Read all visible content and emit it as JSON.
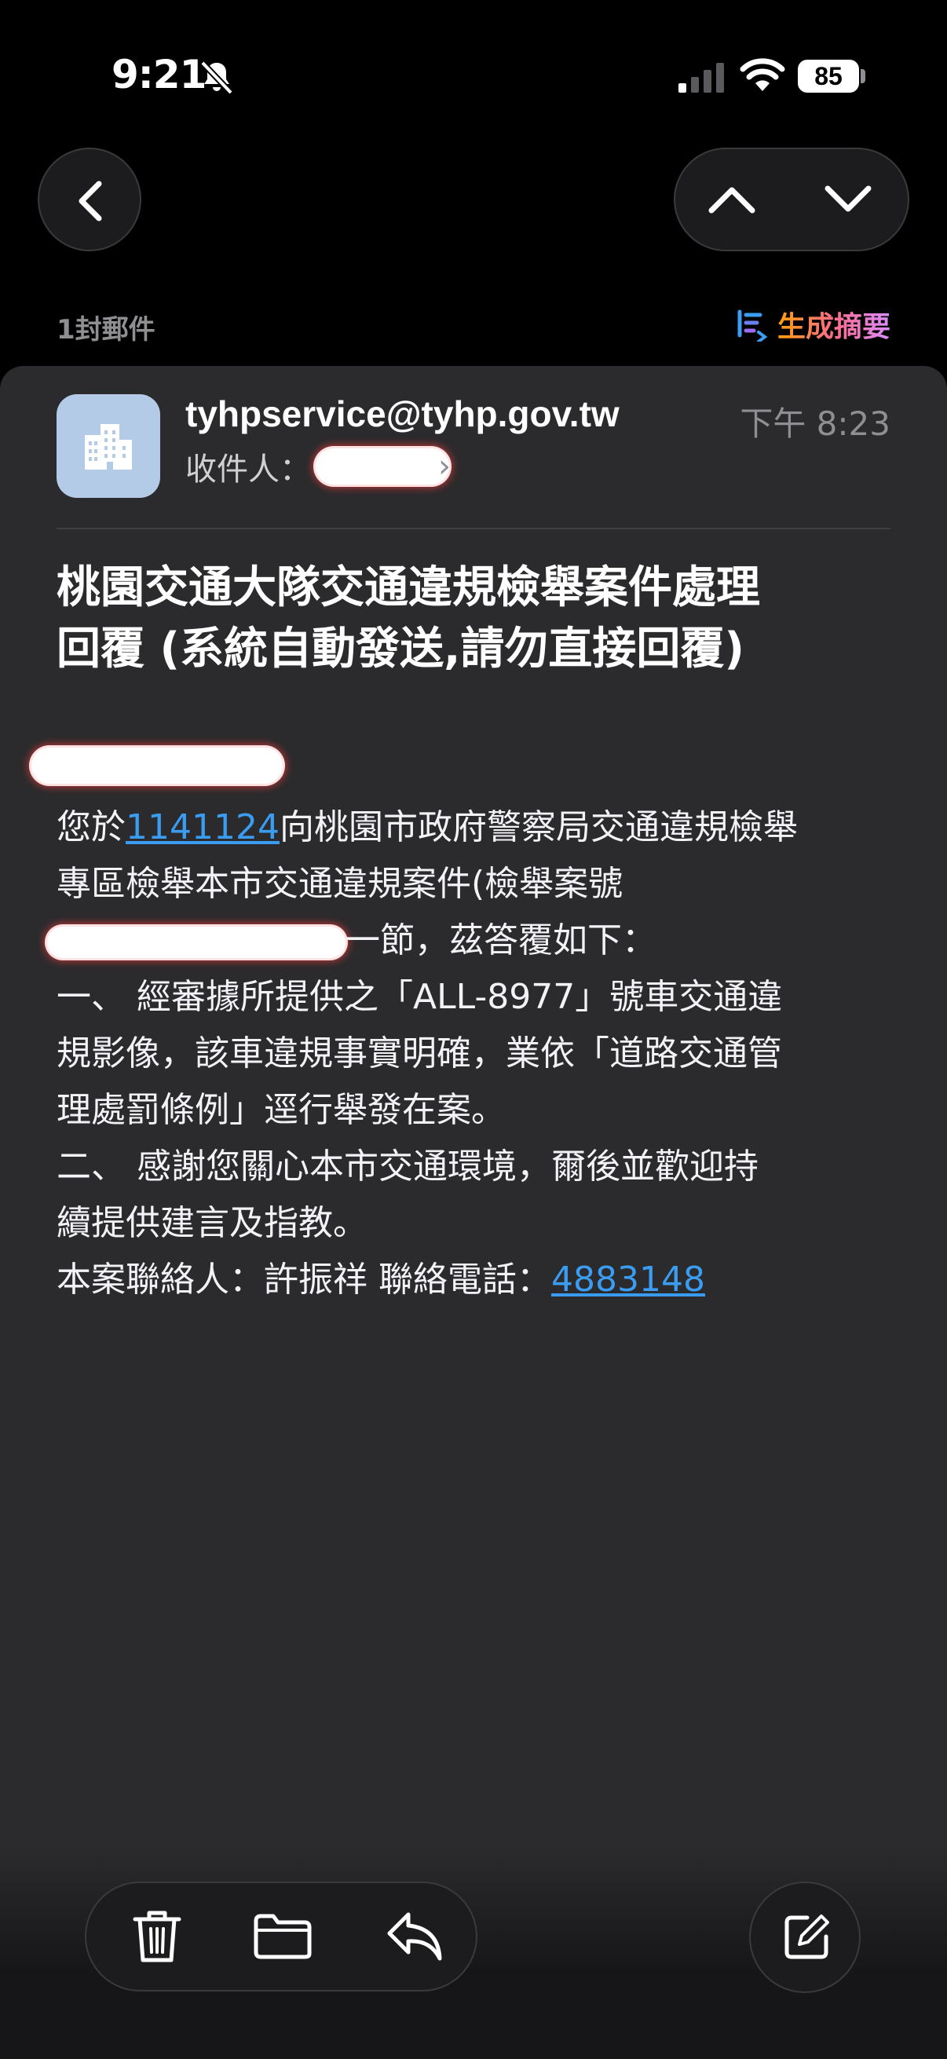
{
  "status_bar": {
    "time": "9:21",
    "battery": "85",
    "icons": [
      "bell-slash-icon",
      "cellular-signal-icon",
      "wifi-icon",
      "battery-icon"
    ]
  },
  "nav": {
    "back_icon": "chevron-left-icon",
    "prev_icon": "chevron-up-icon",
    "next_icon": "chevron-down-icon"
  },
  "thread": {
    "count_label": "1封郵件",
    "summary_label": "生成摘要",
    "summary_icon": "summary-list-icon"
  },
  "mail": {
    "avatar_icon": "building-icon",
    "sender": "tyhpservice@tyhp.gov.tw",
    "recipient_label": "收件人：",
    "time": "下午 8:23",
    "subject_line1": "桃園交通大隊交通違規檢舉案件處理",
    "subject_line2": "回覆 (系統自動發送,請勿直接回覆)",
    "body": {
      "l1_pre": "您於",
      "l1_link": "1141124",
      "l1_post": "向桃園市政府警察局交通違規檢舉",
      "l2": "專區檢舉本市交通違規案件(檢舉案號",
      "l3_post": "一節，茲答覆如下：",
      "l4": "一、 經審據所提供之「ALL-8977」號車交通違",
      "l5": "規影像，該車違規事實明確，業依「道路交通管",
      "l6": "理處罰條例」逕行舉發在案。",
      "l7": "二、 感謝您關心本市交通環境，爾後並歡迎持",
      "l8": "續提供建言及指教。",
      "l9_pre": "本案聯絡人：許振祥 聯絡電話：",
      "l9_link": "4883148"
    }
  },
  "toolbar": {
    "delete_icon": "trash-icon",
    "move_icon": "folder-icon",
    "reply_icon": "reply-icon",
    "compose_icon": "compose-icon"
  },
  "colors": {
    "background": "#000000",
    "card": "#2b2b2d",
    "link": "#3a9df2",
    "avatar": "#b4cbe8"
  }
}
